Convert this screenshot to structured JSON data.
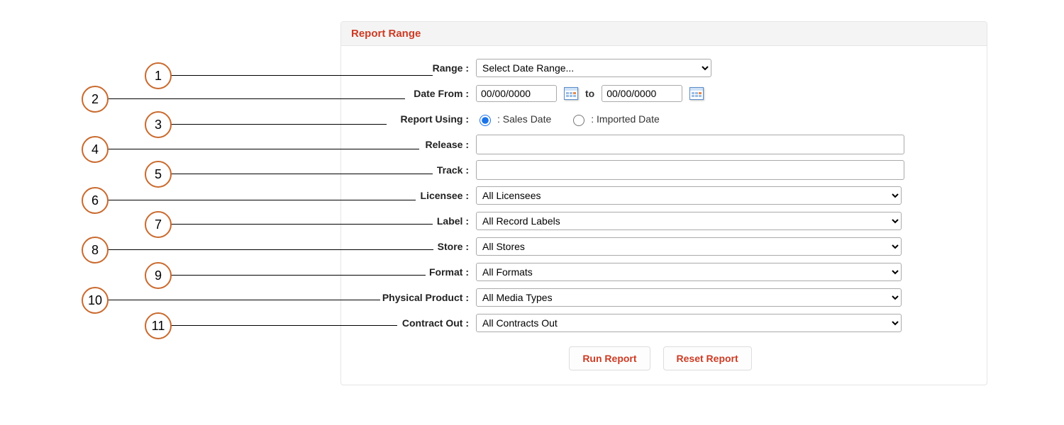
{
  "panel": {
    "title": "Report Range"
  },
  "labels": {
    "range": "Range :",
    "date_from": "Date From :",
    "to": "to",
    "report_using": "Report Using :",
    "release": "Release :",
    "track": "Track :",
    "licensee": "Licensee :",
    "label": "Label :",
    "store": "Store :",
    "format": "Format :",
    "physical_product": "Physical Product :",
    "contract_out": "Contract Out :"
  },
  "fields": {
    "range": {
      "selected": "Select Date Range..."
    },
    "date_from": {
      "value": "00/00/0000"
    },
    "date_to": {
      "value": "00/00/0000"
    },
    "report_using": {
      "option_a": ": Sales Date",
      "option_b": ": Imported Date",
      "selected": "a"
    },
    "release": {
      "value": ""
    },
    "track": {
      "value": ""
    },
    "licensee": {
      "selected": "All Licensees"
    },
    "label": {
      "selected": "All Record Labels"
    },
    "store": {
      "selected": "All Stores"
    },
    "format": {
      "selected": "All Formats"
    },
    "physical_product": {
      "selected": "All Media Types"
    },
    "contract_out": {
      "selected": "All Contracts Out"
    }
  },
  "buttons": {
    "run": "Run Report",
    "reset": "Reset Report"
  },
  "callouts": [
    "1",
    "2",
    "3",
    "4",
    "5",
    "6",
    "7",
    "8",
    "9",
    "10",
    "11"
  ]
}
